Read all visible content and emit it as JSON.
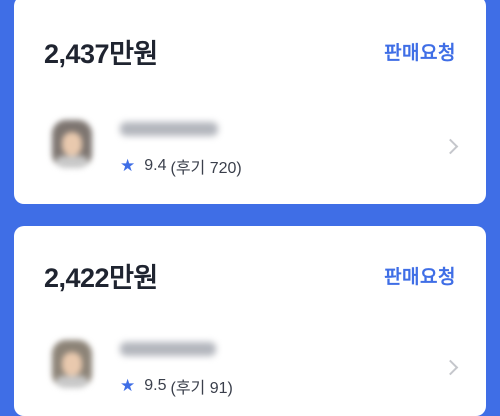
{
  "offers": [
    {
      "price": "2,437만원",
      "action_label": "판매요청",
      "rating_value": "9.4",
      "review_text": "(후기 720)"
    },
    {
      "price": "2,422만원",
      "action_label": "판매요청",
      "rating_value": "9.5",
      "review_text": "(후기 91)"
    }
  ],
  "colors": {
    "background": "#3f6ee6",
    "accent": "#3f6ee6",
    "card": "#ffffff",
    "price_text": "#1f2430"
  },
  "icons": {
    "rating": "star-icon",
    "detail": "chevron-right-icon"
  }
}
